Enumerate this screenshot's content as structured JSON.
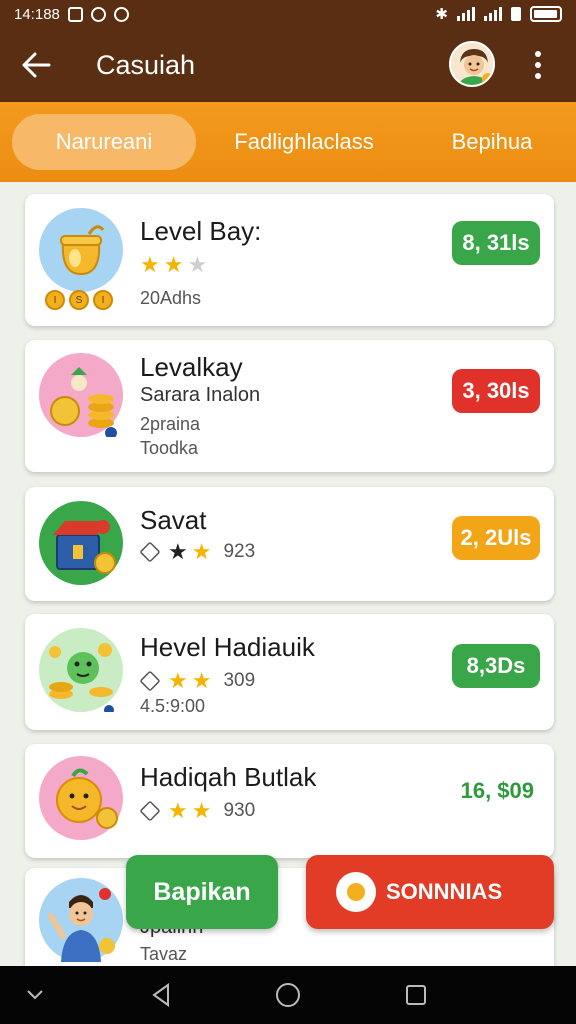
{
  "status_bar": {
    "time": "14:188"
  },
  "app_bar": {
    "title": "Casuiah"
  },
  "tabs": [
    {
      "label": "Narureani",
      "active": true
    },
    {
      "label": "Fadlighlaclass",
      "active": false
    },
    {
      "label": "Bepihua",
      "active": false
    }
  ],
  "items": [
    {
      "title": "Level Bay:",
      "stars": "2 of 3",
      "line2": "20Adhs",
      "badges": "I  SI  II",
      "price": "8, 31ls",
      "price_color": "#3aa64a",
      "thumb_color": "#a6d4f2",
      "icon": "honey-pot-icon"
    },
    {
      "title": "Levalkay",
      "subtitle": "Sarara Inalon",
      "line2": "2praina",
      "line3": "Toodka",
      "price": "3, 30ls",
      "price_color": "#e0312a",
      "thumb_color": "#f5a9c9",
      "icon": "coin-stack-icon"
    },
    {
      "title": "Savat",
      "stars_count": "923",
      "price": "2, 2Uls",
      "price_color": "#f2a516",
      "thumb_color": "#3aa64a",
      "icon": "treasure-box-icon"
    },
    {
      "title": "Hevel Hadiauik",
      "stars_count": "309",
      "line2": "4.5:9:00",
      "price": "8,3Ds",
      "price_color": "#3aa64a",
      "thumb_color": "#c9ecc4",
      "icon": "coin-pile-icon"
    },
    {
      "title": "Hadiqah Butlak",
      "stars_count": "930",
      "price": "16, $09",
      "price_color": "#2e9a3c",
      "thumb_color": "#f5a9c9",
      "icon": "orange-character-icon"
    },
    {
      "title": "Tavaz",
      "line_top": "Jpaiinn",
      "thumb_color": "#a6d4f2",
      "icon": "person-waving-icon"
    }
  ],
  "buttons": {
    "left": "Bapikan",
    "right": "SONNNIAS"
  }
}
